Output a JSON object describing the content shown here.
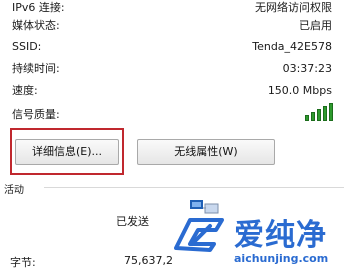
{
  "details": [
    {
      "label": "IPv6 连接:",
      "value": "无网络访问权限"
    },
    {
      "label": "媒体状态:",
      "value": "已启用"
    },
    {
      "label": "SSID:",
      "value": "Tenda_42E578"
    },
    {
      "label": "持续时间:",
      "value": "03:37:23"
    },
    {
      "label": "速度:",
      "value": "150.0 Mbps"
    },
    {
      "label": "信号质量:",
      "value": ""
    }
  ],
  "buttons": {
    "details": "详细信息(E)...",
    "wireless_properties": "无线属性(W)"
  },
  "activity": {
    "title": "活动",
    "sent_label": "已发送",
    "bytes_label": "字节:",
    "bytes_sent": "75,637,2"
  },
  "watermark": {
    "text": "爱纯净",
    "url": "aichunjing.com"
  },
  "colors": {
    "highlight": "#c0282e",
    "signal": "#2e9a2e",
    "watermark": "#2a6bd1"
  },
  "icons": {
    "signal": "signal-strength-icon",
    "network": "network-activity-icon",
    "logo": "aichunjing-logo-icon"
  }
}
